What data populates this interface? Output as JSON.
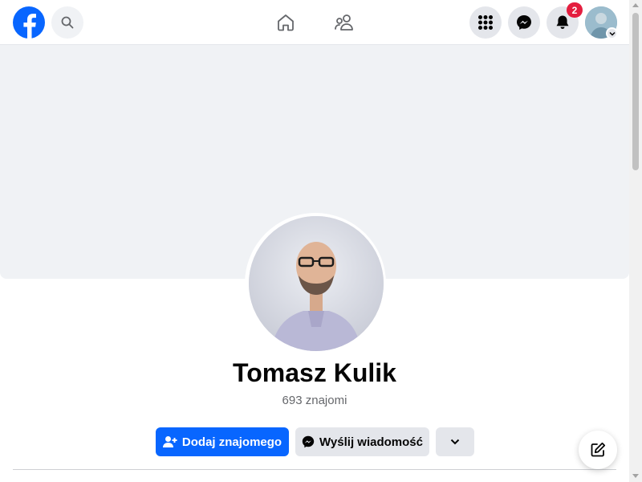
{
  "header": {
    "logo_icon": "facebook-logo-icon",
    "search_icon": "search-icon",
    "nav": [
      {
        "icon": "home-icon"
      },
      {
        "icon": "friends-icon"
      }
    ],
    "actions": [
      {
        "icon": "menu-grid-icon"
      },
      {
        "icon": "messenger-icon"
      },
      {
        "icon": "bell-icon"
      }
    ],
    "notifications_count": "2",
    "account_caret_icon": "chevron-down-icon"
  },
  "profile": {
    "name": "Tomasz Kulik",
    "friends_count": "693 znajomi",
    "add_friend_label": "Dodaj znajomego",
    "message_label": "Wyślij wiadomość",
    "more_icon": "chevron-down-icon"
  },
  "floating": {
    "compose_icon": "compose-icon"
  },
  "colors": {
    "brand": "#0866ff",
    "badge": "#e41e3f",
    "secondary_button": "#e4e6eb",
    "cover": "#f0f2f5"
  }
}
